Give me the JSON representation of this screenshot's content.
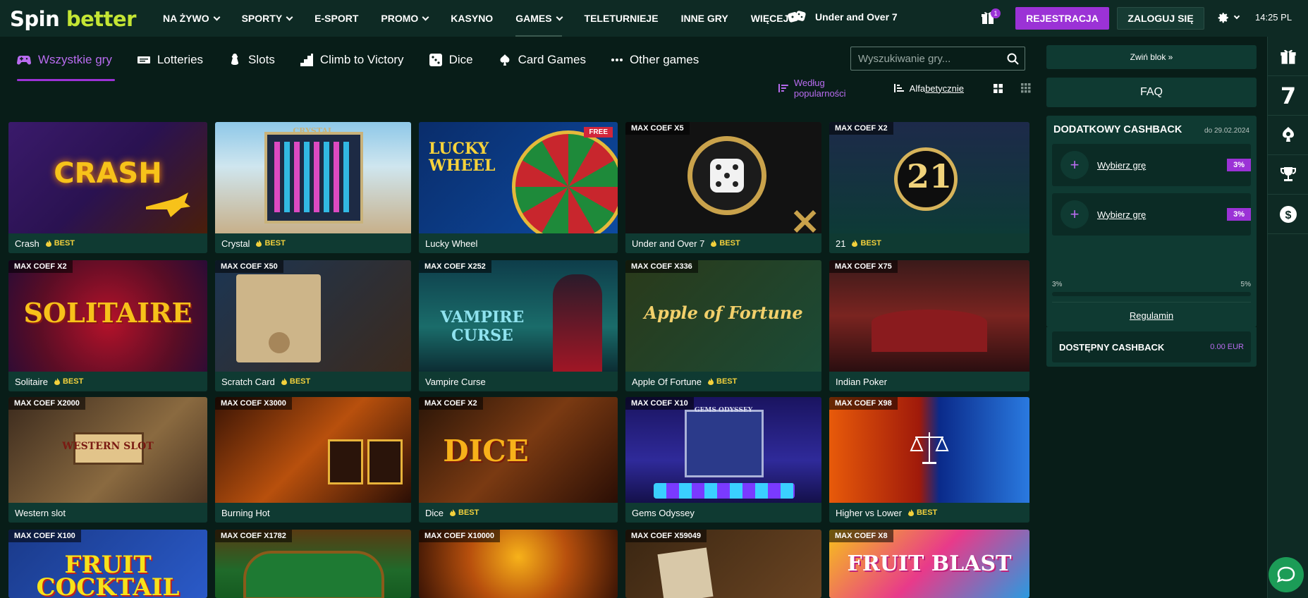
{
  "logo": {
    "part1": "Spin",
    "part2": "better"
  },
  "nav": {
    "items": [
      {
        "label": "NA ŻYWO",
        "dropdown": true
      },
      {
        "label": "SPORTY",
        "dropdown": true
      },
      {
        "label": "E-SPORT",
        "dropdown": false
      },
      {
        "label": "PROMO",
        "dropdown": true
      },
      {
        "label": "KASYNO",
        "dropdown": false
      },
      {
        "label": "GAMES",
        "dropdown": true
      },
      {
        "label": "TELETURNIEJE",
        "dropdown": false
      },
      {
        "label": "INNE GRY",
        "dropdown": false
      },
      {
        "label": "WIĘCEJ",
        "dropdown": true
      }
    ],
    "featured_game": "Under and Over 7",
    "gift_count": "1",
    "register_label": "REJESTRACJA",
    "login_label": "ZALOGUJ SIĘ",
    "time": "14:25",
    "lang": "PL"
  },
  "tabs": [
    {
      "label": "Wszystkie gry",
      "icon": "gamepad-icon"
    },
    {
      "label": "Lotteries",
      "icon": "lottery-icon"
    },
    {
      "label": "Slots",
      "icon": "slots-icon"
    },
    {
      "label": "Climb to Victory",
      "icon": "stairs-icon"
    },
    {
      "label": "Dice",
      "icon": "dice-icon"
    },
    {
      "label": "Card Games",
      "icon": "card-icon"
    },
    {
      "label": "Other games",
      "icon": "more-icon"
    }
  ],
  "search": {
    "placeholder": "Wyszukiwanie gry..."
  },
  "sort": {
    "popularity": "Według popularności",
    "alpha_prefix": "Alfa",
    "alpha_rest": "betycznie"
  },
  "games": [
    {
      "name": "Crash",
      "best": "BEST",
      "coef": "",
      "free": "",
      "art": "CRASH"
    },
    {
      "name": "Crystal",
      "best": "BEST",
      "coef": "",
      "free": "",
      "art": "CRYSTAL"
    },
    {
      "name": "Lucky Wheel",
      "best": "",
      "coef": "",
      "free": "FREE",
      "art": "LUCKY WHEEL"
    },
    {
      "name": "Under and Over 7",
      "best": "BEST",
      "coef": "MAX COEF X5",
      "free": "",
      "art": ""
    },
    {
      "name": "21",
      "best": "BEST",
      "coef": "MAX COEF X2",
      "free": "",
      "art": "21"
    },
    {
      "name": "Solitaire",
      "best": "BEST",
      "coef": "MAX COEF X2",
      "free": "",
      "art": "SOLITAIRE"
    },
    {
      "name": "Scratch Card",
      "best": "BEST",
      "coef": "MAX COEF X50",
      "free": "",
      "art": ""
    },
    {
      "name": "Vampire Curse",
      "best": "",
      "coef": "MAX COEF X252",
      "free": "",
      "art": "VAMPIRE CURSE"
    },
    {
      "name": "Apple Of Fortune",
      "best": "BEST",
      "coef": "MAX COEF X336",
      "free": "",
      "art": "Apple of Fortune"
    },
    {
      "name": "Indian Poker",
      "best": "",
      "coef": "MAX COEF X75",
      "free": "",
      "art": ""
    },
    {
      "name": "Western slot",
      "best": "",
      "coef": "MAX COEF X2000",
      "free": "",
      "art": "WESTERN SLOT"
    },
    {
      "name": "Burning Hot",
      "best": "",
      "coef": "MAX COEF X3000",
      "free": "",
      "art": ""
    },
    {
      "name": "Dice",
      "best": "BEST",
      "coef": "MAX COEF X2",
      "free": "",
      "art": "DICE"
    },
    {
      "name": "Gems Odyssey",
      "best": "",
      "coef": "MAX COEF X10",
      "free": "",
      "art": "GEMS ODYSSEY"
    },
    {
      "name": "Higher vs Lower",
      "best": "BEST",
      "coef": "MAX COEF X98",
      "free": "",
      "art": ""
    },
    {
      "name": "",
      "best": "",
      "coef": "MAX COEF X100",
      "free": "",
      "art": "FRUIT COCKTAIL"
    },
    {
      "name": "",
      "best": "",
      "coef": "MAX COEF X1782",
      "free": "",
      "art": ""
    },
    {
      "name": "",
      "best": "",
      "coef": "MAX COEF X10000",
      "free": "",
      "art": ""
    },
    {
      "name": "",
      "best": "",
      "coef": "MAX COEF X59049",
      "free": "",
      "art": ""
    },
    {
      "name": "",
      "best": "",
      "coef": "MAX COEF X8",
      "free": "",
      "art": "FRUIT BLAST"
    }
  ],
  "sidebar": {
    "collapse_label": "Zwiń blok",
    "faq_label": "FAQ",
    "cashback_title": "DODATKOWY CASHBACK",
    "cashback_date": "do 29.02.2024",
    "rows": [
      {
        "link": "Wybierz grę",
        "pct": "3%"
      },
      {
        "link": "Wybierz grę",
        "pct": "3%"
      }
    ],
    "scale_min": "3%",
    "scale_max": "5%",
    "regulamin": "Regulamin",
    "available_label": "DOSTĘPNY CASHBACK",
    "available_value": "0.00 EUR"
  },
  "rail": {
    "number": "7"
  },
  "colors": {
    "accent": "#9b32d6",
    "brand": "#c4e534",
    "panel": "#0f3a32",
    "bg": "#081d18",
    "best": "#f3d13c"
  }
}
